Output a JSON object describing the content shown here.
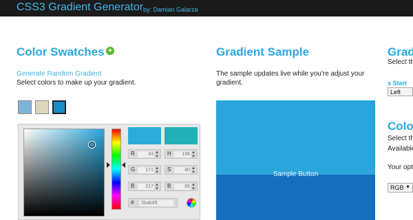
{
  "header": {
    "title": "CSS3 Gradient Generator",
    "byline": "by: Damian Galarza"
  },
  "swatches_panel": {
    "title": "Color Swatches",
    "add_icon": "plus-circle-icon",
    "random_link": "Generate Random Gradient",
    "instruction": "Select colors to make up your gradient.",
    "swatch_colors": [
      "#7fb4da",
      "#dcd6bd",
      "#1a8cc8"
    ]
  },
  "picker": {
    "current_color": "#2babd9",
    "original_color": "#1fb0b8",
    "fields": {
      "r": {
        "label": "R",
        "value": "43"
      },
      "g": {
        "label": "G",
        "value": "171"
      },
      "b": {
        "label": "B",
        "value": "217"
      },
      "h": {
        "label": "H",
        "value": "196"
      },
      "s": {
        "label": "S",
        "value": "80"
      },
      "br": {
        "label": "B",
        "value": "85"
      }
    },
    "hex": {
      "label": "#",
      "value": "2babd9"
    },
    "wheel_icon": "color-wheel-icon"
  },
  "sample_panel": {
    "title": "Gradient Sample",
    "description_line1": "The sample updates live while you're adjust your",
    "description_line2": "gradient.",
    "button_label": "Sample Button",
    "top_color": "#2aa6dc",
    "bottom_color": "#1670c2"
  },
  "right_panel": {
    "title1": "Grad",
    "text1": "Select th",
    "xstart_label": "x Start",
    "select1_value": "Left",
    "title2": "Colo",
    "text2": "Select th",
    "text3": "Available",
    "text4": "Your opt",
    "select2_value": "RGB"
  }
}
